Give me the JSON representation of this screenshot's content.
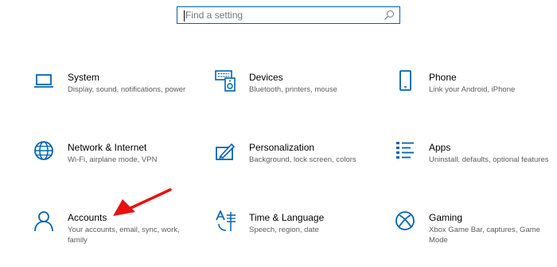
{
  "search": {
    "placeholder": "Find a setting"
  },
  "tiles": [
    {
      "title": "System",
      "desc": "Display, sound, notifications, power",
      "icon": "laptop-icon"
    },
    {
      "title": "Devices",
      "desc": "Bluetooth, printers, mouse",
      "icon": "keyboard-speaker-icon"
    },
    {
      "title": "Phone",
      "desc": "Link your Android, iPhone",
      "icon": "phone-icon"
    },
    {
      "title": "Network & Internet",
      "desc": "Wi-Fi, airplane mode, VPN",
      "icon": "globe-icon"
    },
    {
      "title": "Personalization",
      "desc": "Background, lock screen, colors",
      "icon": "paint-brush-icon"
    },
    {
      "title": "Apps",
      "desc": "Uninstall, defaults, optional features",
      "icon": "apps-list-icon"
    },
    {
      "title": "Accounts",
      "desc": "Your accounts, email, sync, work, family",
      "icon": "person-icon"
    },
    {
      "title": "Time & Language",
      "desc": "Speech, region, date",
      "icon": "time-language-icon"
    },
    {
      "title": "Gaming",
      "desc": "Xbox Game Bar, captures, Game Mode",
      "icon": "xbox-icon"
    }
  ],
  "colors": {
    "accent": "#0063b1",
    "annotation_arrow": "#e81010"
  }
}
